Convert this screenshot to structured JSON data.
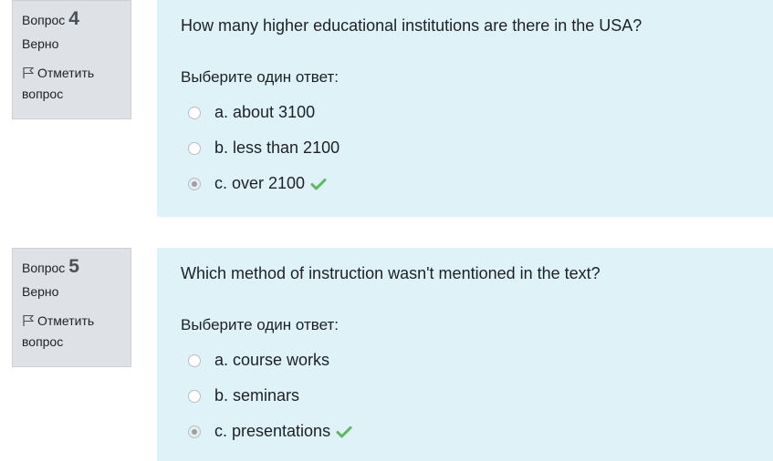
{
  "questions": [
    {
      "number_label": "Вопрос",
      "number": "4",
      "state": "Верно",
      "flag_label": "Отметить вопрос",
      "text": "How many higher educational institutions are there in the USA?",
      "prompt": "Выберите один ответ:",
      "answers": [
        {
          "label": "a.  about 3100",
          "checked": false,
          "correct_mark": false
        },
        {
          "label": "b. less than 2100",
          "checked": false,
          "correct_mark": false
        },
        {
          "label": "c. over 2100",
          "checked": true,
          "correct_mark": true
        }
      ]
    },
    {
      "number_label": "Вопрос",
      "number": "5",
      "state": "Верно",
      "flag_label": "Отметить вопрос",
      "text": "Which method of instruction wasn't mentioned in the text?",
      "prompt": "Выберите один ответ:",
      "answers": [
        {
          "label": "a. course works",
          "checked": false,
          "correct_mark": false
        },
        {
          "label": "b.  seminars",
          "checked": false,
          "correct_mark": false
        },
        {
          "label": "c. presentations",
          "checked": true,
          "correct_mark": true
        }
      ]
    }
  ],
  "colors": {
    "info_bg": "#dee2e6",
    "content_bg": "#def2f8",
    "correct_green": "#5cb85c"
  },
  "icons": {
    "flag": "flag-icon",
    "correct": "check-icon"
  }
}
